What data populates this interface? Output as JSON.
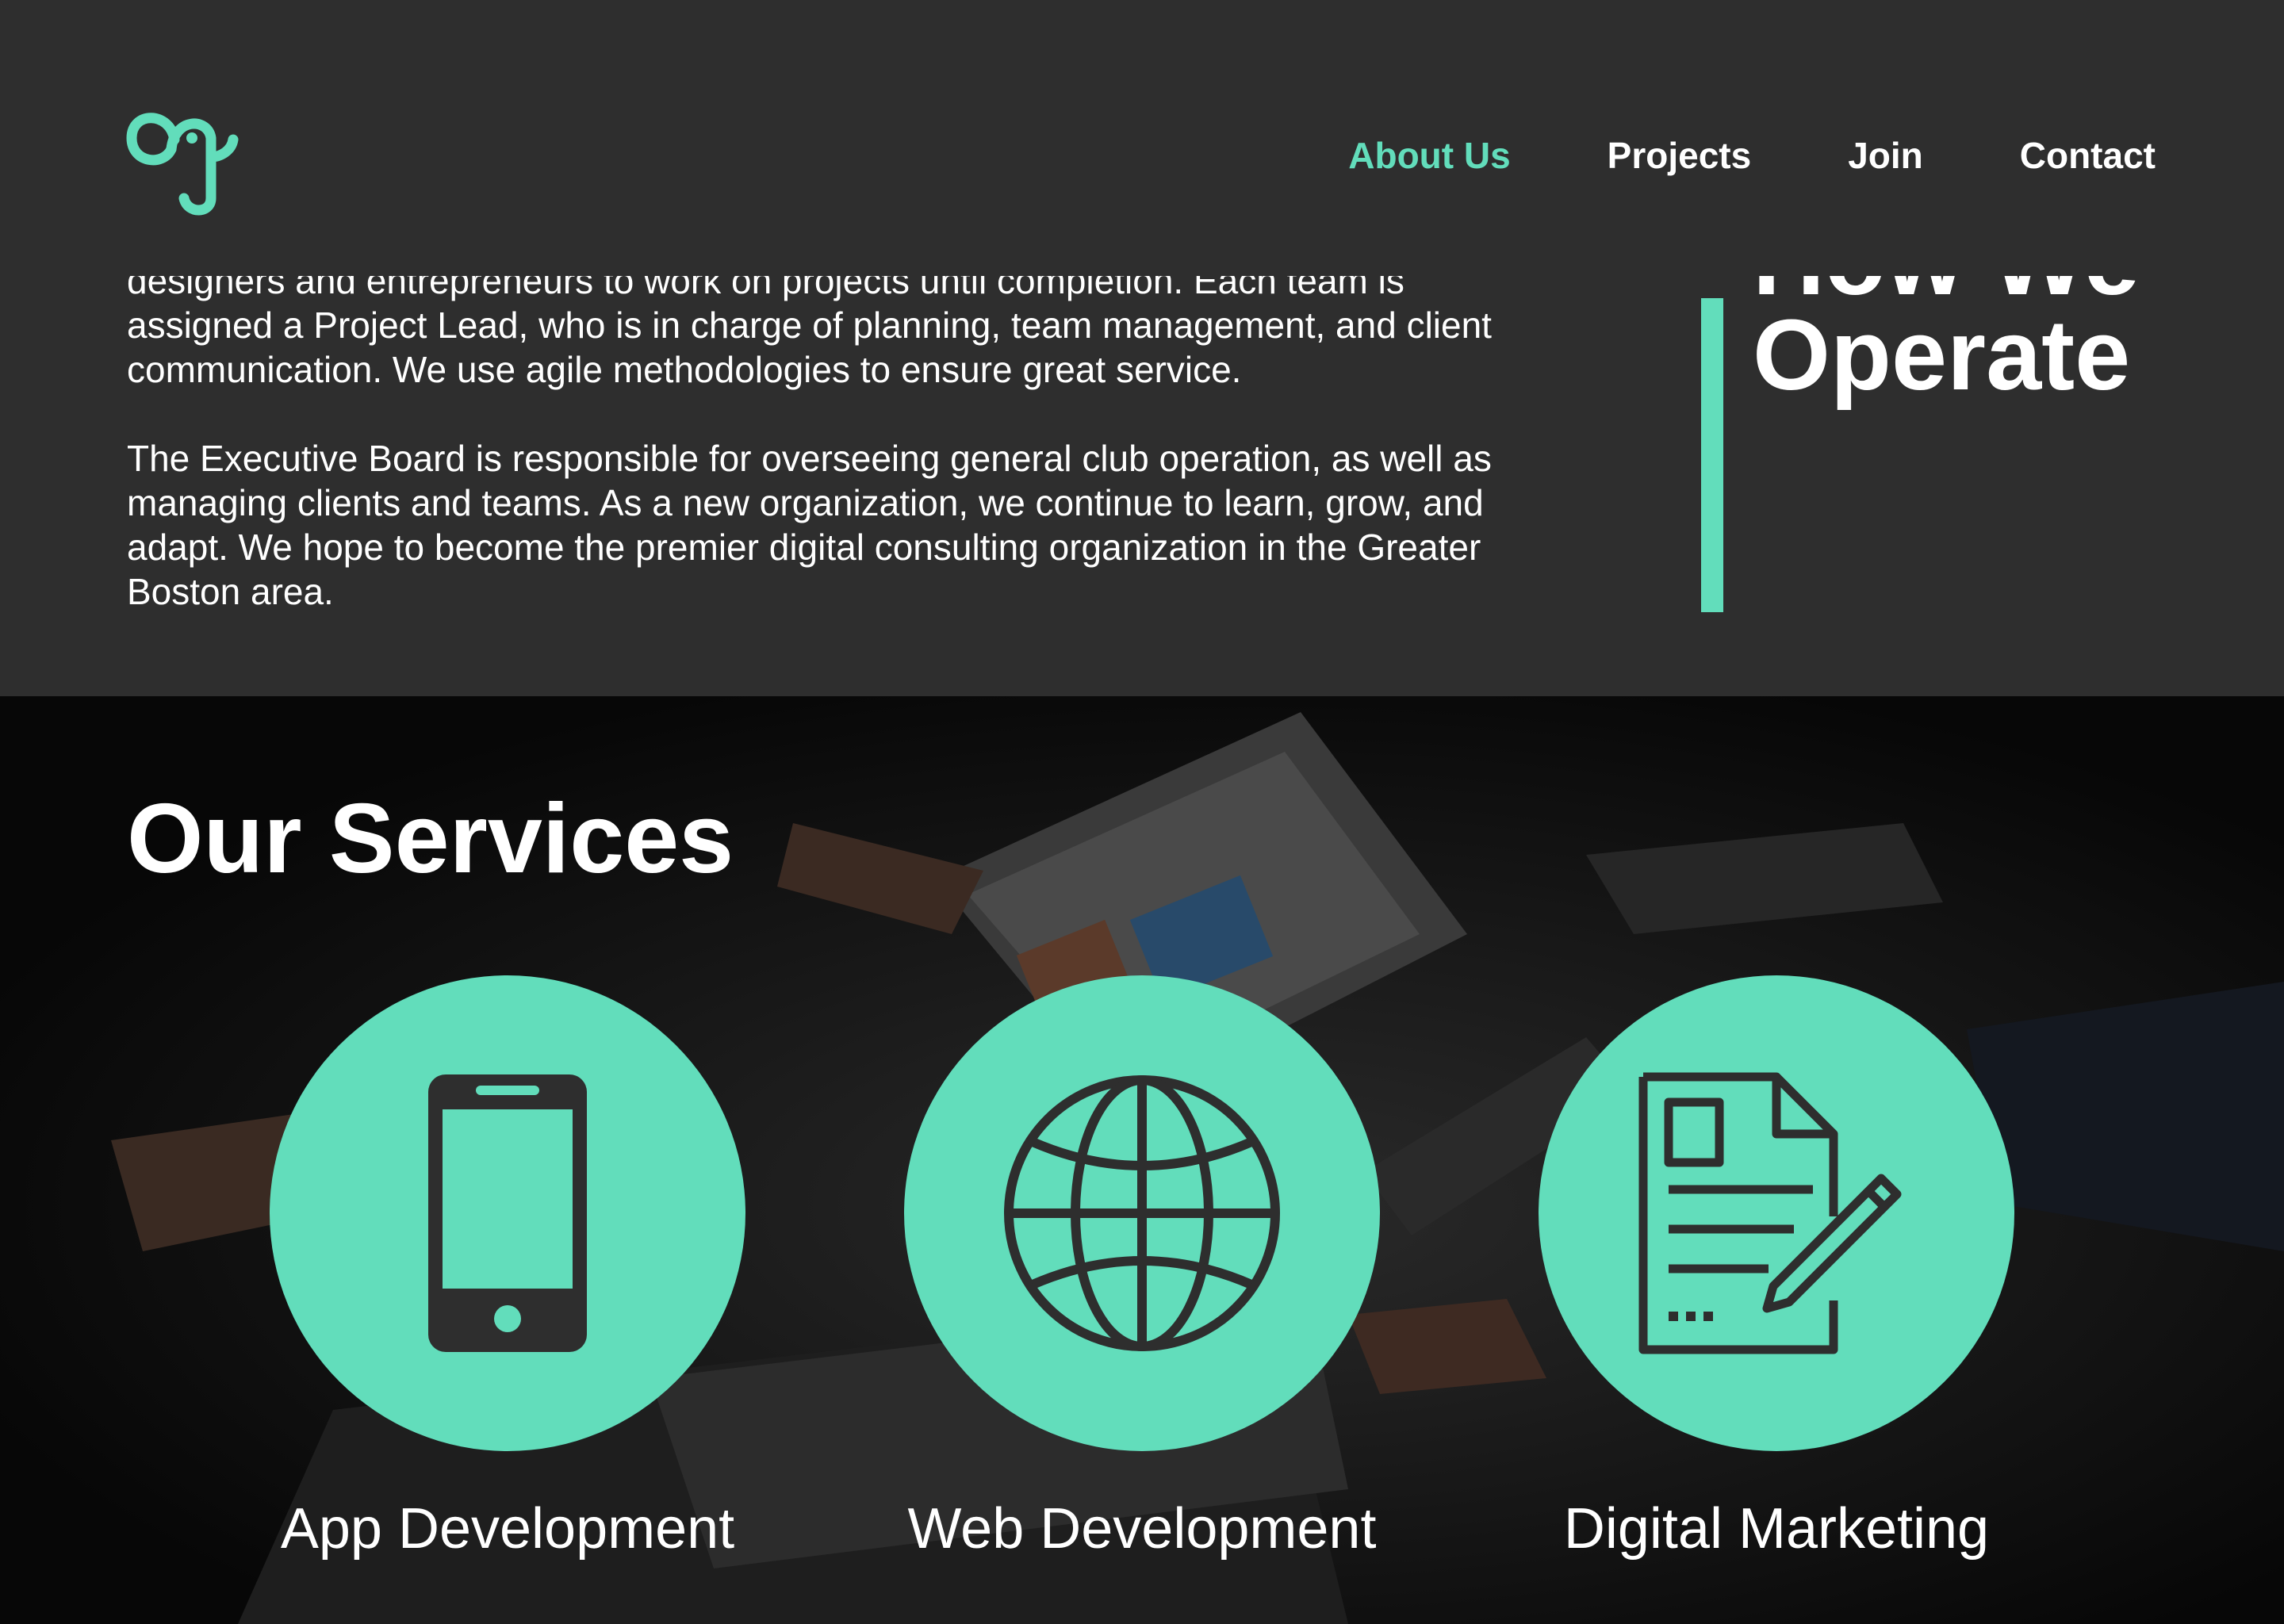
{
  "brand": {
    "logo_icon": "elephant-logo-icon",
    "accent_color": "#62ddbb",
    "background_color": "#2e2e2e",
    "text_color": "#ffffff"
  },
  "nav": {
    "items": [
      {
        "label": "About Us",
        "active": true
      },
      {
        "label": "Projects",
        "active": false
      },
      {
        "label": "Join",
        "active": false
      },
      {
        "label": "Contact",
        "active": false
      }
    ]
  },
  "operate": {
    "heading_line1": "How We",
    "heading_line2": "Operate",
    "paragraph1_line1": "designers and entrepreneurs to work on projects until completion. Each team is",
    "paragraph1_line2": "assigned a Project Lead, who is in charge of planning, team management, and client",
    "paragraph1_line3": "communication. We use agile methodologies to ensure great service.",
    "paragraph2": "The Executive Board is responsible for overseeing general club operation, as well as managing clients and teams. As a new organization, we continue to learn, grow, and adapt. We hope to become the premier digital consulting organization in the Greater Boston area."
  },
  "services": {
    "title": "Our Services",
    "items": [
      {
        "label": "App Development",
        "icon": "smartphone-icon"
      },
      {
        "label": "Web Development",
        "icon": "globe-icon"
      },
      {
        "label": "Digital Marketing",
        "icon": "document-pencil-icon"
      }
    ]
  }
}
